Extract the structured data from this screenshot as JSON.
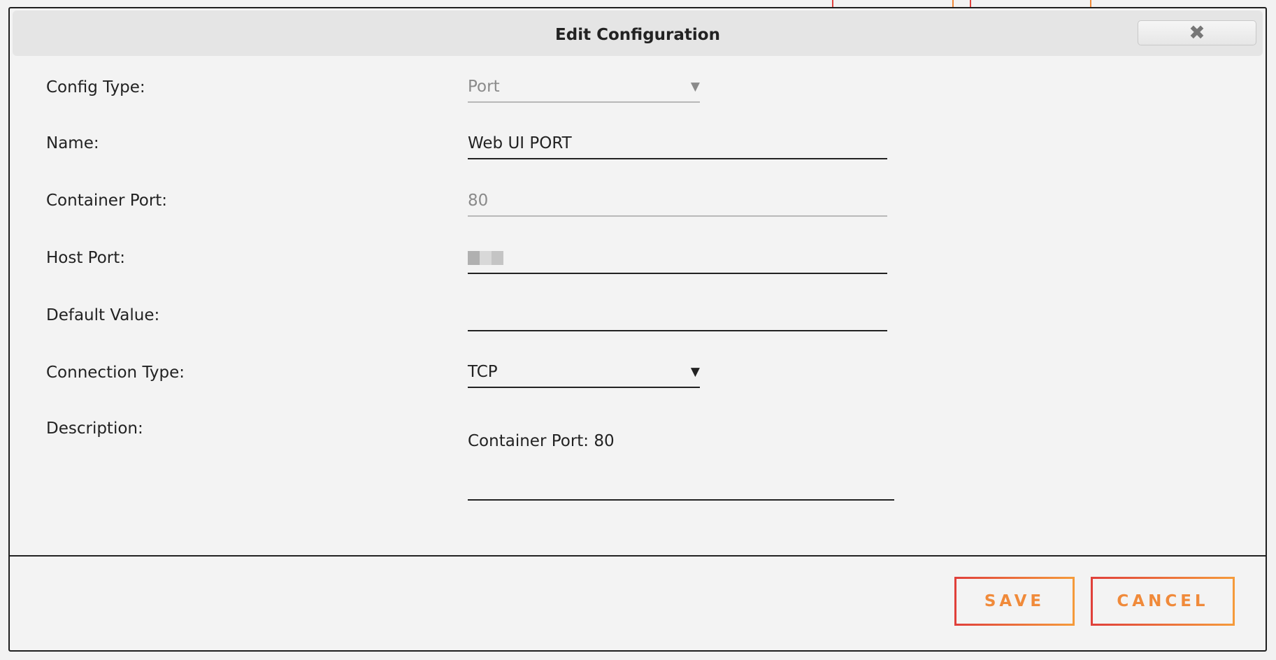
{
  "dialog": {
    "title": "Edit Configuration"
  },
  "form": {
    "config_type": {
      "label": "Config Type:",
      "value": "Port",
      "disabled": true
    },
    "name": {
      "label": "Name:",
      "value": "Web UI PORT"
    },
    "container_port": {
      "label": "Container Port:",
      "value": "80",
      "disabled": true
    },
    "host_port": {
      "label": "Host Port:",
      "value_redacted": true
    },
    "default_value": {
      "label": "Default Value:",
      "value": ""
    },
    "connection_type": {
      "label": "Connection Type:",
      "value": "TCP"
    },
    "description": {
      "label": "Description:",
      "value": "Container Port: 80"
    }
  },
  "footer": {
    "save_label": "SAVE",
    "cancel_label": "CANCEL"
  },
  "icons": {
    "close": "close-icon",
    "dropdown": "triangle-down-icon"
  },
  "colors": {
    "accent_orange": "#f08a3a",
    "accent_red": "#e0433f",
    "background": "#f3f3f3",
    "titlebar": "#e5e5e5"
  }
}
